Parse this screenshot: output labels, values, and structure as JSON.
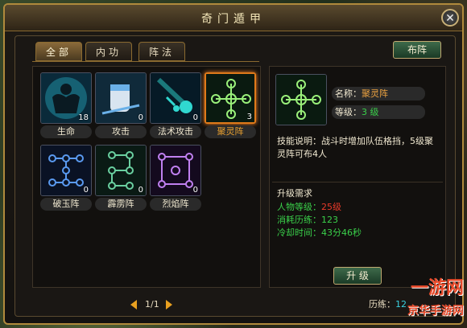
{
  "window": {
    "title": "奇门遁甲",
    "close_label": "✕"
  },
  "tabs": [
    {
      "label": "全部",
      "active": true
    },
    {
      "label": "内功",
      "active": false
    },
    {
      "label": "阵法",
      "active": false
    }
  ],
  "deploy_button": "布阵",
  "skills": [
    {
      "name": "生命",
      "level": "18",
      "icon": "muscle-figure-icon",
      "color": "#2fc8e0"
    },
    {
      "name": "攻击",
      "level": "0",
      "icon": "fist-icon",
      "color": "#6ab0e8"
    },
    {
      "name": "法术攻击",
      "level": "0",
      "icon": "comet-icon",
      "color": "#30d8d0"
    },
    {
      "name": "聚灵阵",
      "level": "3",
      "icon": "cross-formation-icon",
      "color": "#9af07a",
      "selected": true
    },
    {
      "name": "破玉阵",
      "level": "0",
      "icon": "ring-formation-icon",
      "color": "#5a9af0"
    },
    {
      "name": "霹雳阵",
      "level": "0",
      "icon": "s-formation-icon",
      "color": "#6ad0a0"
    },
    {
      "name": "烈焰阵",
      "level": "0",
      "icon": "flame-formation-icon",
      "color": "#c080f0"
    }
  ],
  "detail": {
    "name_label": "名称：",
    "name_value": "聚灵阵",
    "level_label": "等级：",
    "level_value": "3 级",
    "desc_label": "技能说明：",
    "desc_text": "战斗时增加队伍格挡，5级聚灵阵可布4人",
    "req_title": "升级需求",
    "req_player_label": "人物等级：",
    "req_player_value": "25级",
    "req_exp_label": "消耗历练：",
    "req_exp_value": "123",
    "req_cd_label": "冷却时间：",
    "req_cd_value": "43分46秒",
    "upgrade_button": "升 级"
  },
  "pager": {
    "text": "1/1"
  },
  "footer": {
    "exp_label": "历练：",
    "exp_value": "12"
  },
  "watermark": {
    "line1": "一游网",
    "line2": "京华手游网"
  },
  "colors": {
    "accent_orange": "#e07a1a",
    "green": "#3ad04a",
    "red": "#e83a2a",
    "gold_border": "#b08a3c"
  }
}
